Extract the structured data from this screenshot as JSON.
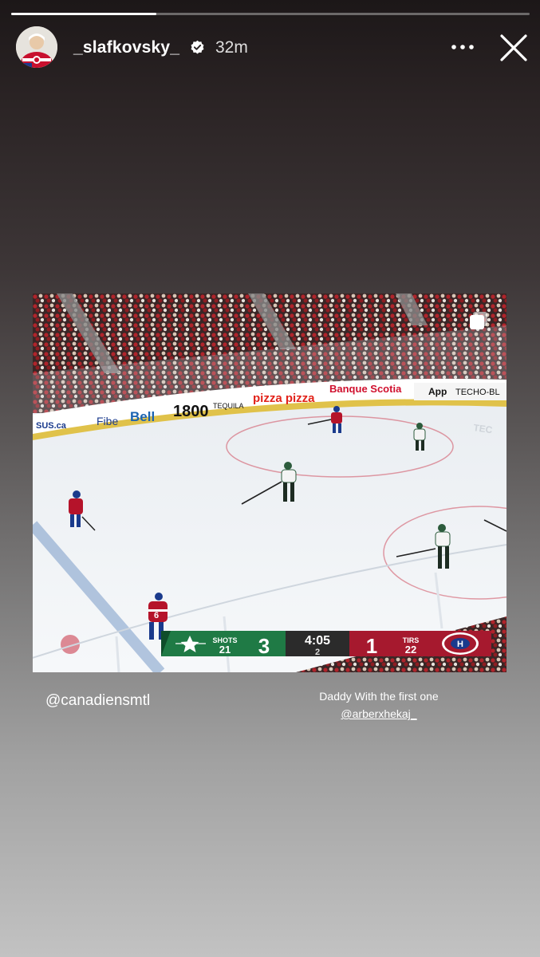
{
  "story": {
    "progress": 0.28,
    "username": "_slafkovsky_",
    "time_ago": "32m",
    "verified": true
  },
  "post": {
    "ads": {
      "sus": "SUS.ca",
      "fibe": "Fibe",
      "bell": "Bell",
      "tequila_num": "1800",
      "tequila_word": "TEQUILA",
      "pizza": "pizza pizza",
      "banque": "Banque Scotia",
      "app": "App",
      "techo": "TECHO-BL",
      "board_right": "TEC"
    },
    "scoreboard": {
      "away_shots_label": "SHOTS",
      "away_shots": "21",
      "away_score": "3",
      "clock": "4:05",
      "period": "2",
      "home_score": "1",
      "home_shots_label": "TIRS",
      "home_shots": "22",
      "away_color": "#1f7a45",
      "home_color": "#a6192e"
    },
    "player_number": "6"
  },
  "mentions": {
    "team": "@canadiensmtl",
    "caption_line1": "Daddy With the first one",
    "caption_tag": "@arberxhekaj_"
  },
  "icons": [
    "verified-badge-icon",
    "more-options-icon",
    "close-icon",
    "carousel-icon",
    "stars-logo-icon",
    "canadiens-logo-icon"
  ]
}
